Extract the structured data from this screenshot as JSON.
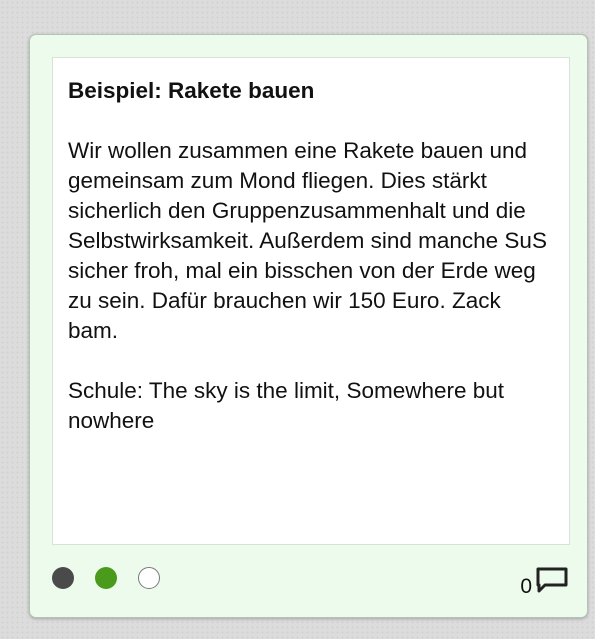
{
  "card": {
    "title": "Beispiel: Rakete bauen",
    "description": "Wir wollen zusammen eine Rakete bauen und gemeinsam zum Mond fliegen. Dies stärkt sicherlich den Gruppenzusammenhalt und die Selbstwirksamkeit. Außerdem sind manche SuS sicher froh, mal ein bisschen von der Erde weg zu sein. Dafür brauchen wir 150 Euro. Zack bam.",
    "school": "Schule: The sky is the limit, Somewhere but nowhere"
  },
  "footer": {
    "status_dots": [
      {
        "state": "filled",
        "color": "#4a4a4a"
      },
      {
        "state": "filled",
        "color": "#4a9a1c"
      },
      {
        "state": "empty",
        "color": "#ffffff"
      }
    ],
    "comment_count": "0",
    "comment_icon": "comment-icon"
  }
}
